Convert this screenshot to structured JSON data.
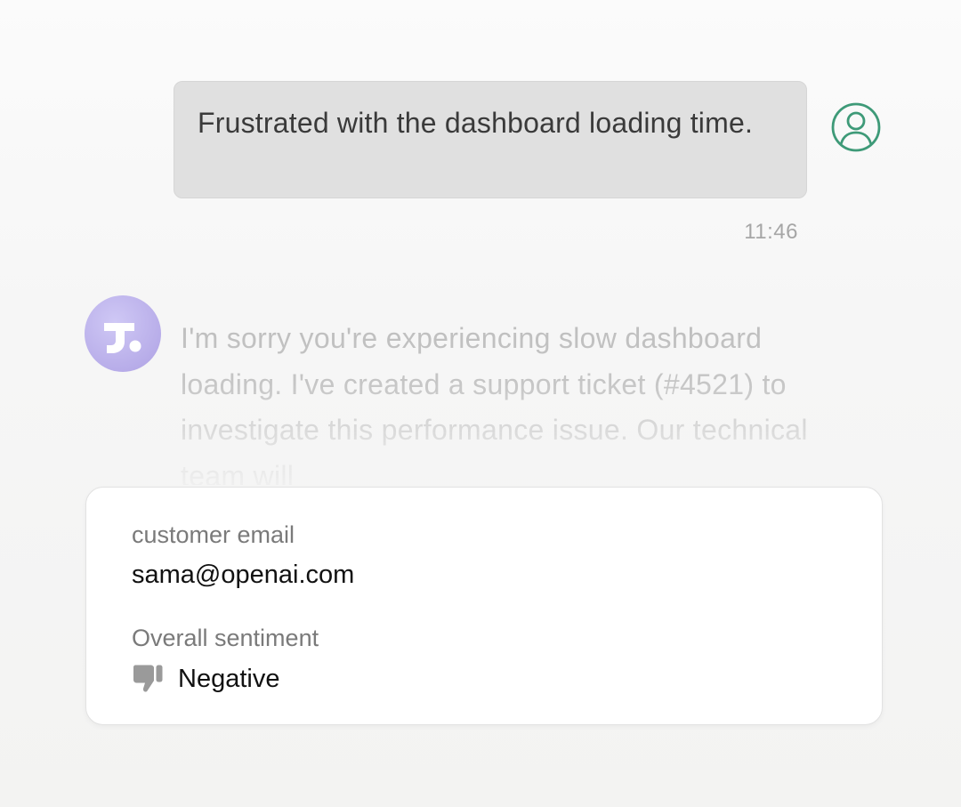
{
  "conversation": {
    "user_message": "Frustrated with the dashboard loading time.",
    "timestamp": "11:46",
    "bot_message": "I'm sorry you're experiencing slow dashboard loading. I've created a support ticket (#4521) to investigate this performance issue. Our technical team will"
  },
  "info_card": {
    "email_label": "customer email",
    "email_value": "sama@openai.com",
    "sentiment_label": "Overall sentiment",
    "sentiment_value": "Negative"
  },
  "icons": {
    "user_avatar": "user-circle-icon",
    "bot_avatar": "assistant-logo-icon",
    "sentiment": "thumbs-down-icon"
  },
  "colors": {
    "user_avatar_accent": "#3e9a78",
    "bot_avatar_bg": "#b8ade9",
    "user_bubble_bg": "#e0e0e0",
    "sentiment_icon": "#9a9a9a"
  }
}
